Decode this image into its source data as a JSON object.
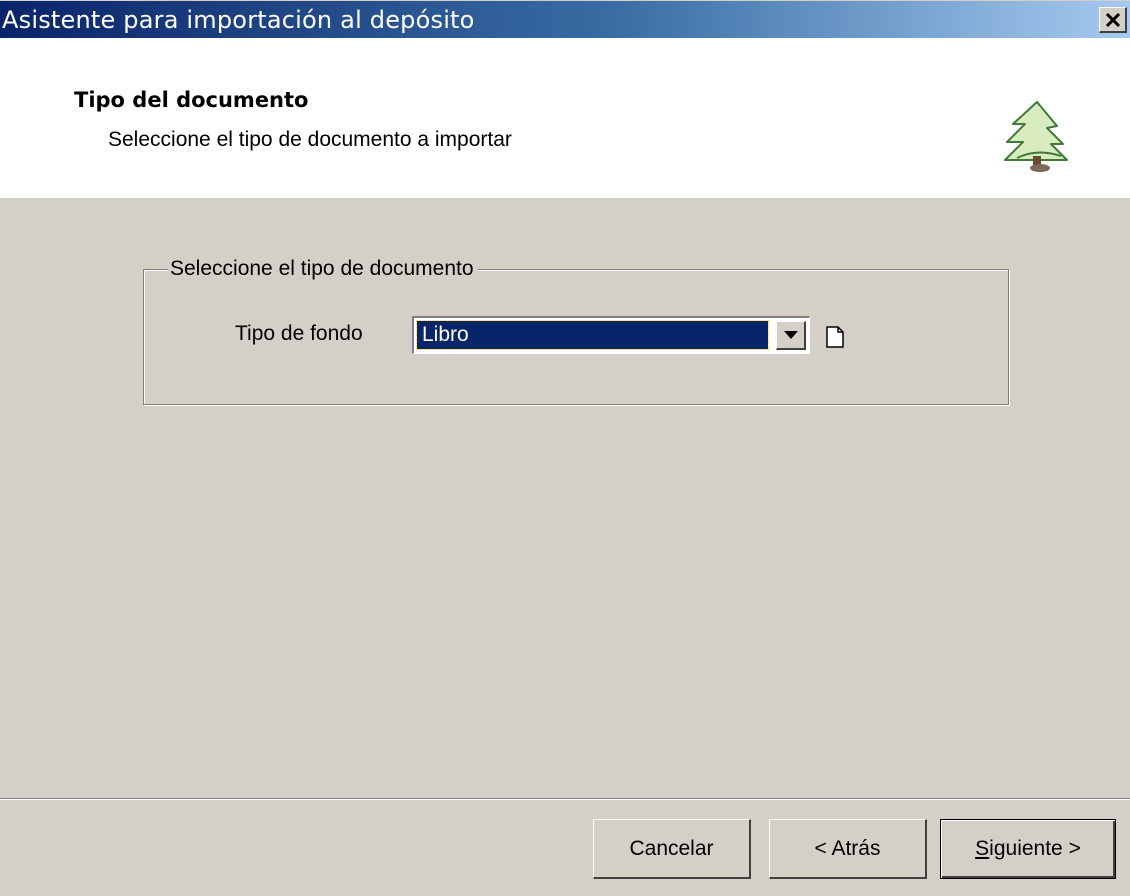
{
  "window": {
    "title": "Asistente para importación al depósito",
    "close_label": "close"
  },
  "header": {
    "title": "Tipo del documento",
    "subtitle": "Seleccione el tipo de documento a importar",
    "logo_icon": "tree-icon"
  },
  "group": {
    "legend": "Seleccione el tipo de documento",
    "field_label": "Tipo de fondo",
    "selected_value": "Libro",
    "dropdown_icon": "chevron-down-icon",
    "new_icon": "new-document-icon"
  },
  "buttons": {
    "cancel": "Cancelar",
    "back": "< Atrás",
    "next_mnemonic": "S",
    "next_rest": "iguiente >"
  },
  "colors": {
    "title_gradient_start": "#0a246a",
    "title_gradient_end": "#a6caf0",
    "dialog_bg": "#d4d0c8",
    "selection_bg": "#0a246a"
  }
}
